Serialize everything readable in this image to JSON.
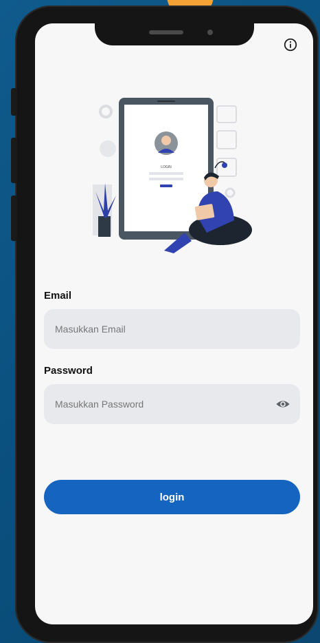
{
  "form": {
    "email_label": "Email",
    "email_placeholder": "Masukkan Email",
    "password_label": "Password",
    "password_placeholder": "Masukkan Password",
    "login_label": "login"
  },
  "illustration": {
    "tablet_caption": "LOGIN"
  },
  "icons": {
    "info": "info-icon",
    "visibility": "eye-icon"
  },
  "colors": {
    "background": "#0f5b8c",
    "accent": "#1565c0",
    "field_bg": "#e8e9ec",
    "screen_bg": "#f7f7f8"
  }
}
